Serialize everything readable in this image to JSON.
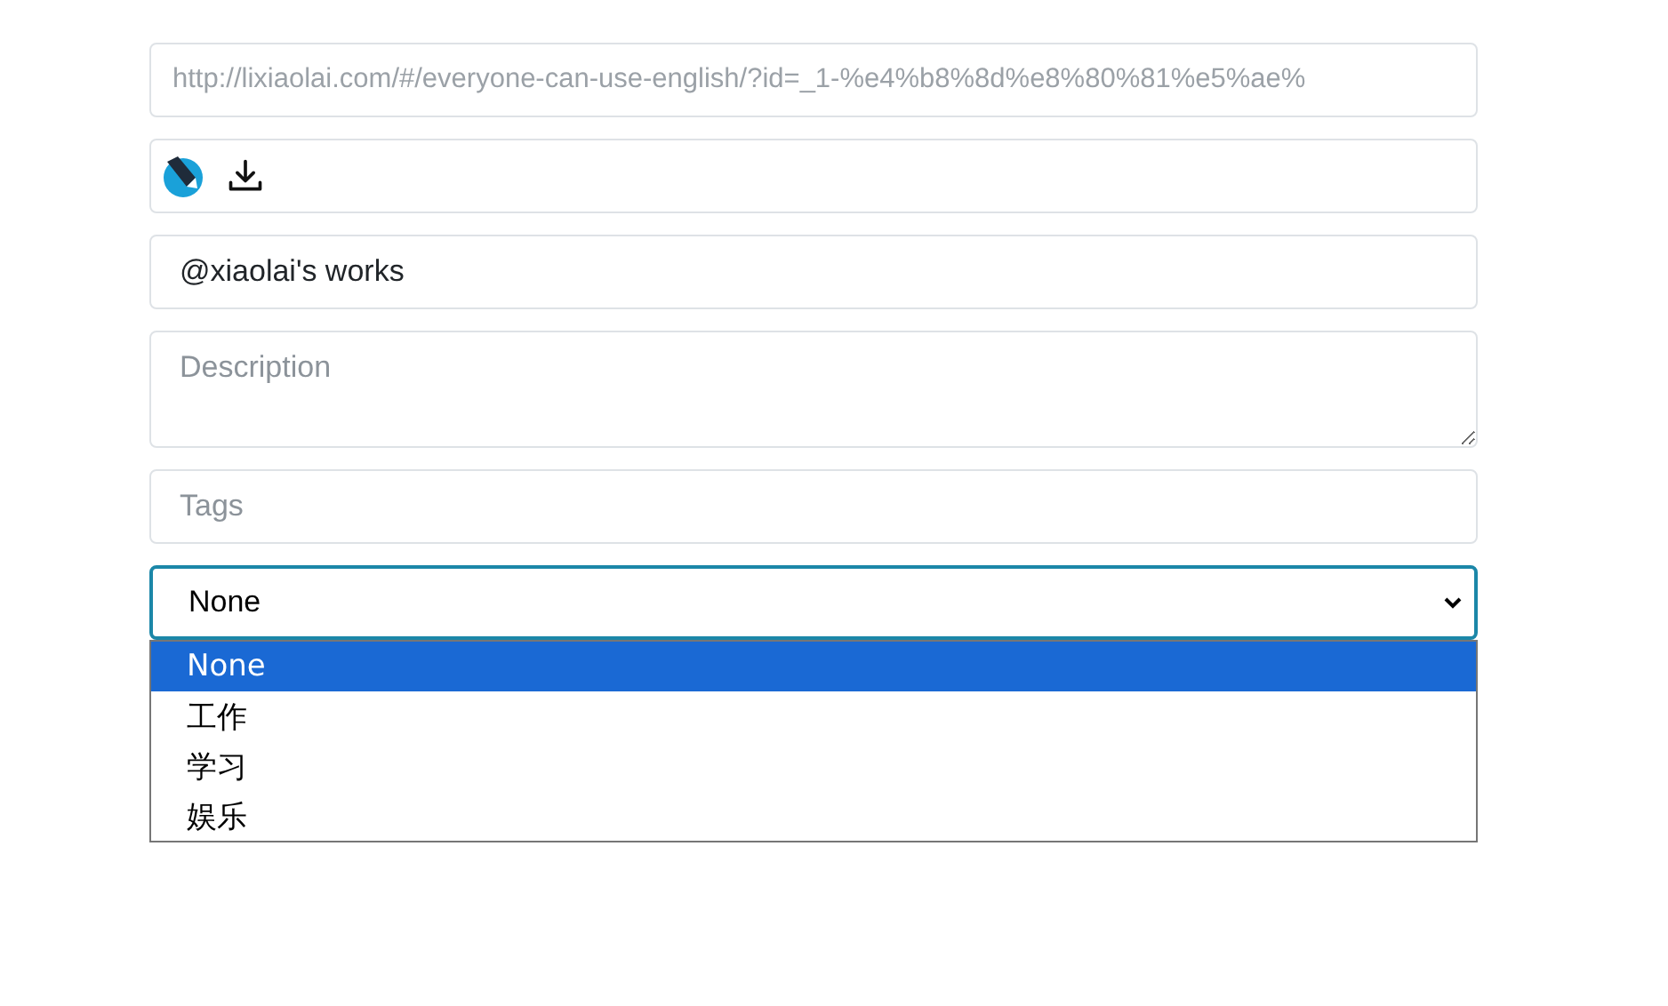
{
  "url_field": {
    "placeholder": "http://lixiaolai.com/#/everyone-can-use-english/?id=_1-%e4%b8%8d%e8%80%81%e5%ae%"
  },
  "title_field": {
    "value": "@xiaolai's works"
  },
  "description_field": {
    "placeholder": "Description"
  },
  "tags_field": {
    "placeholder": "Tags"
  },
  "category_select": {
    "value": "None",
    "expanded": true,
    "options": [
      {
        "label": "None",
        "selected": true
      },
      {
        "label": "工作",
        "selected": false
      },
      {
        "label": "学习",
        "selected": false
      },
      {
        "label": "娱乐",
        "selected": false
      }
    ]
  }
}
